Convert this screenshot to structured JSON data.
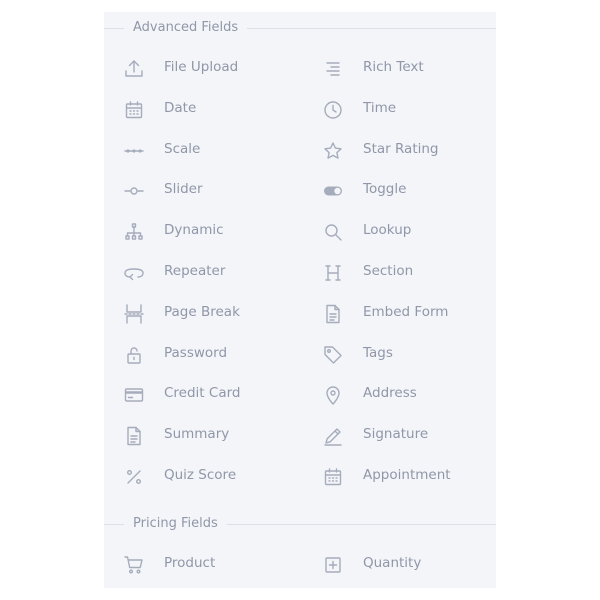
{
  "sections": [
    {
      "title": "Advanced Fields",
      "items": [
        {
          "label": "File Upload",
          "icon": "upload-icon"
        },
        {
          "label": "Rich Text",
          "icon": "rich-text-icon"
        },
        {
          "label": "Date",
          "icon": "calendar-icon"
        },
        {
          "label": "Time",
          "icon": "clock-icon"
        },
        {
          "label": "Scale",
          "icon": "scale-icon"
        },
        {
          "label": "Star Rating",
          "icon": "star-icon"
        },
        {
          "label": "Slider",
          "icon": "slider-icon"
        },
        {
          "label": "Toggle",
          "icon": "toggle-icon"
        },
        {
          "label": "Dynamic",
          "icon": "sitemap-icon"
        },
        {
          "label": "Lookup",
          "icon": "search-icon"
        },
        {
          "label": "Repeater",
          "icon": "repeat-icon"
        },
        {
          "label": "Section",
          "icon": "heading-icon"
        },
        {
          "label": "Page Break",
          "icon": "page-break-icon"
        },
        {
          "label": "Embed Form",
          "icon": "document-icon"
        },
        {
          "label": "Password",
          "icon": "lock-icon"
        },
        {
          "label": "Tags",
          "icon": "tags-icon"
        },
        {
          "label": "Credit Card",
          "icon": "credit-card-icon"
        },
        {
          "label": "Address",
          "icon": "map-pin-icon"
        },
        {
          "label": "Summary",
          "icon": "summary-document-icon"
        },
        {
          "label": "Signature",
          "icon": "pen-icon"
        },
        {
          "label": "Quiz Score",
          "icon": "percent-icon"
        },
        {
          "label": "Appointment",
          "icon": "appointment-calendar-icon"
        }
      ]
    },
    {
      "title": "Pricing Fields",
      "items": [
        {
          "label": "Product",
          "icon": "cart-icon"
        },
        {
          "label": "Quantity",
          "icon": "plus-square-icon"
        }
      ]
    }
  ],
  "colors": {
    "panel_bg": "#f4f5f9",
    "text": "#8f97a8",
    "icon": "#a5acbb",
    "divider": "#dcdfe6"
  }
}
